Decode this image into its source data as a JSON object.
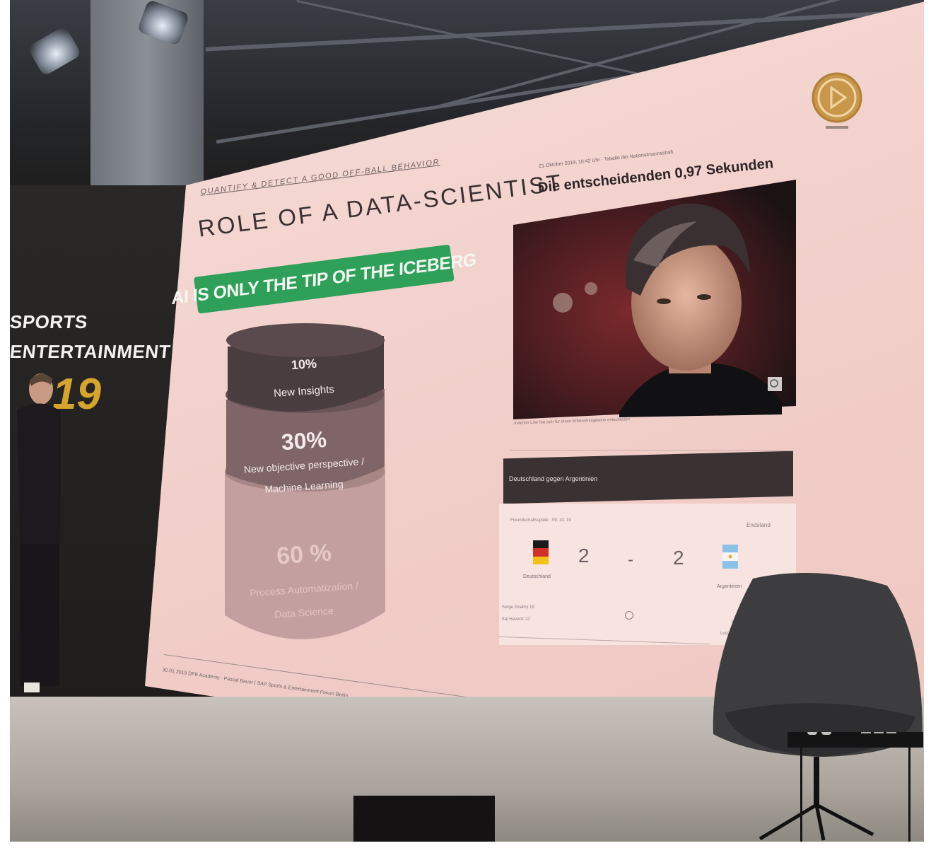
{
  "side_sign": {
    "line1": "SPORTS",
    "line2": "ENTERTAINMENT",
    "year_fragment": "19"
  },
  "slide_left": {
    "kicker": "QUANTIFY & DETECT A GOOD OFF-BALL BEHAVIOR",
    "title": "ROLE OF A DATA-SCIENTIST",
    "banner": "AI IS ONLY THE TIP OF THE ICEBERG",
    "layers": [
      {
        "percent": "10%",
        "label": "New Insights"
      },
      {
        "percent": "30%",
        "label_line1": "New objective perspective /",
        "label_line2": "Machine Learning"
      },
      {
        "percent": "60 %",
        "label_line1": "Process Automatization /",
        "label_line2": "Data Science"
      }
    ],
    "footer": "30.01.2019  DFB Academy · Pascal Bauer | SAP Sports & Entertainment Forum Berlin"
  },
  "slide_right": {
    "article_meta": "21.Oktober 2019, 10:42 Uhr · Tabelle der Nationalmannschaft",
    "article_title": "Die entscheidenden 0,97 Sekunden",
    "photo_caption": "Joachim Löw hat sich für einen Erkenntnisgewinn entschieden",
    "match_title": "Deutschland gegen Argentinien",
    "competition": "Freundschaftsspiele · 09. 10. 19",
    "status": "Endstand",
    "home_team": "Deutschland",
    "away_team": "Argentinien",
    "home_score": "2",
    "separator": "-",
    "away_score": "2",
    "small_line1": "Serge Gnabry 15'",
    "small_line2": "Kai Havertz 22'",
    "tail1": "Lucas",
    "tail2": "Lucas"
  },
  "colors": {
    "banner_green": "#2ea05a",
    "screen_pink": "#f2cfca",
    "sign_gold": "#d5a52d"
  }
}
